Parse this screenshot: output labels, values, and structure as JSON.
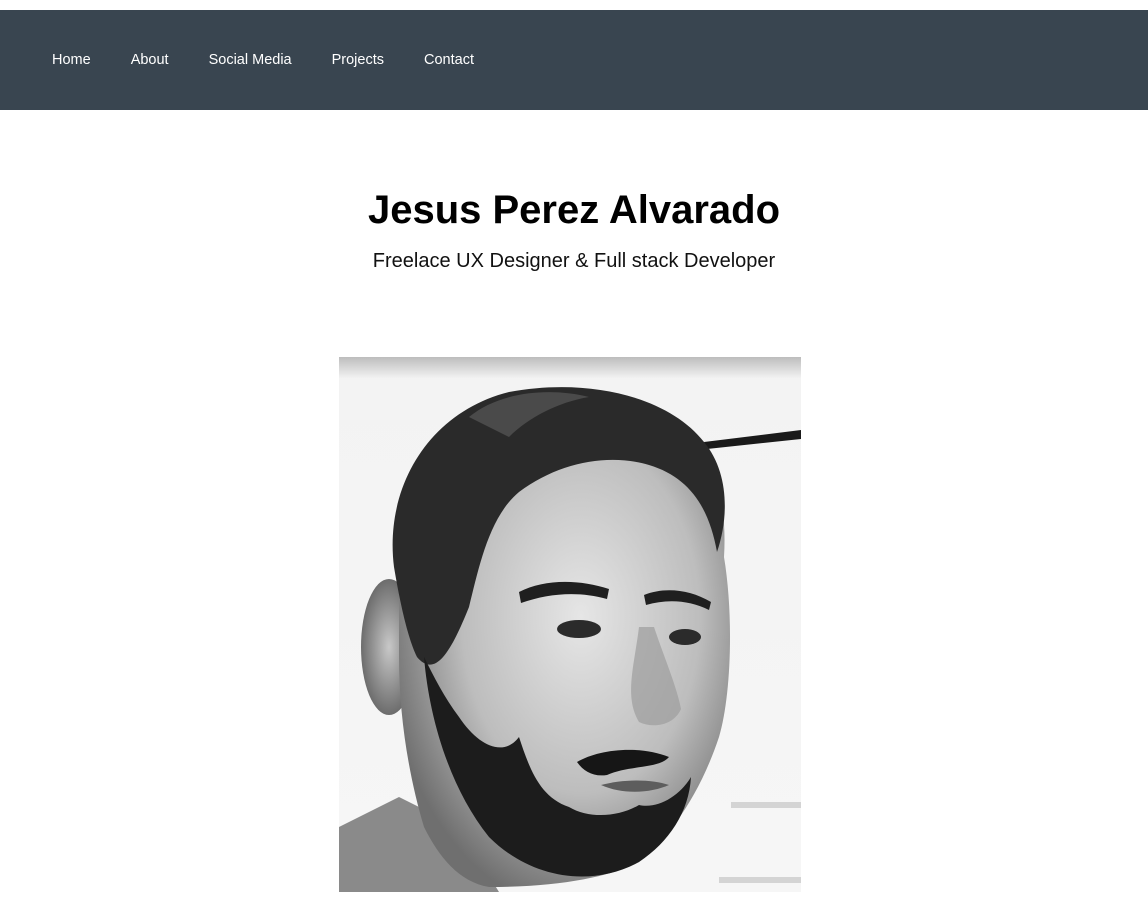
{
  "nav": {
    "items": [
      {
        "label": "Home"
      },
      {
        "label": "About"
      },
      {
        "label": "Social Media"
      },
      {
        "label": "Projects"
      },
      {
        "label": "Contact"
      }
    ]
  },
  "hero": {
    "name": "Jesus Perez Alvarado",
    "tagline": "Freelace UX Designer & Full stack Developer"
  },
  "portrait": {
    "style": "grayscale"
  },
  "colors": {
    "navbar_bg": "#394550",
    "nav_text": "#ffffff",
    "page_bg": "#ffffff"
  }
}
